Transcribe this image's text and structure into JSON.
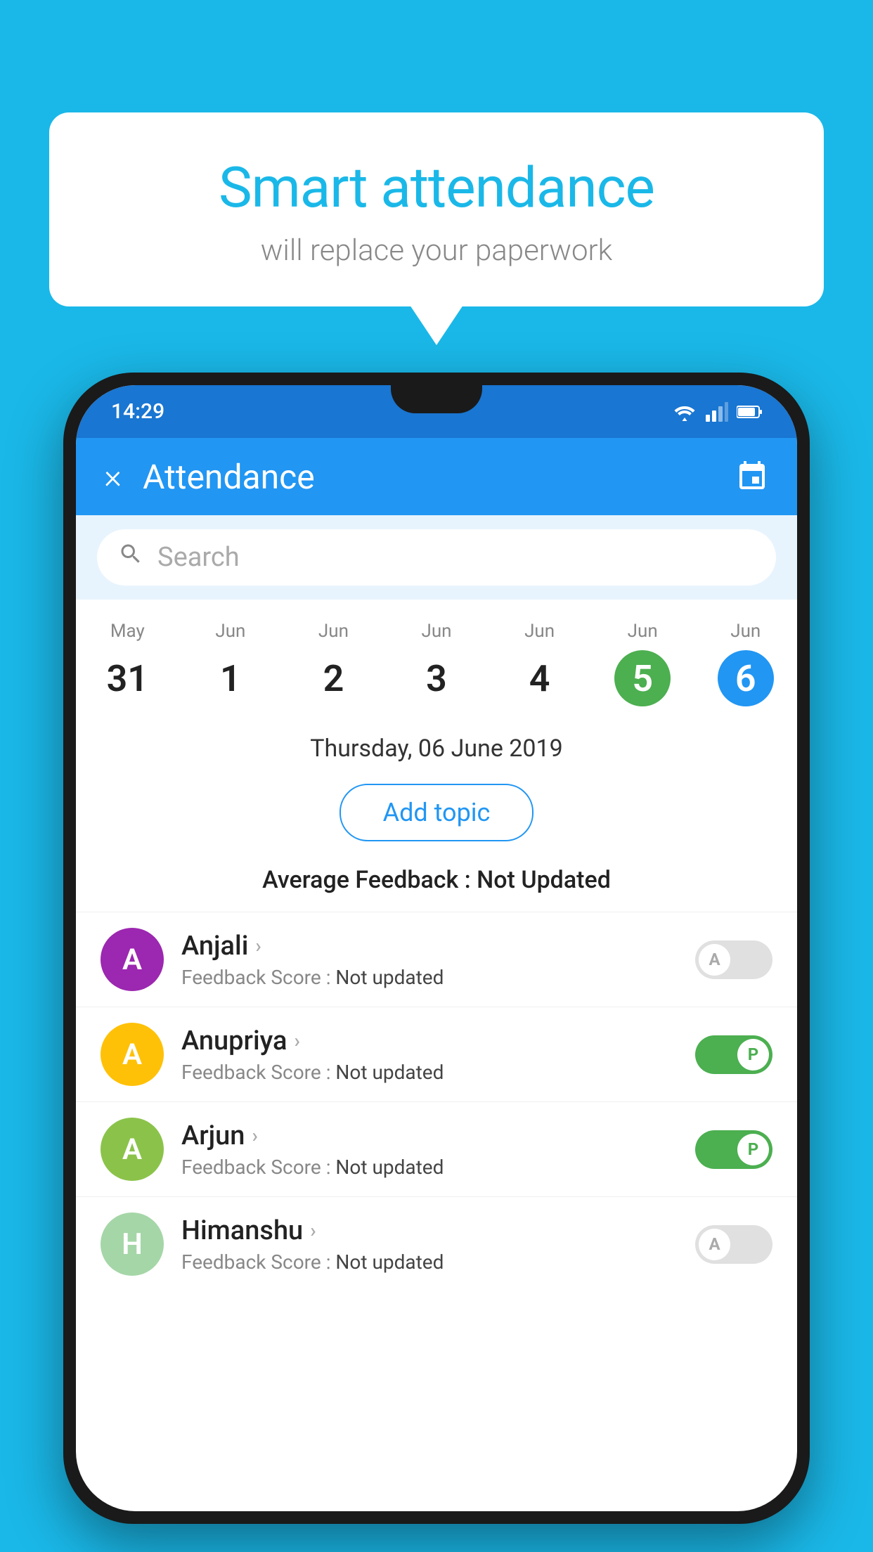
{
  "background_color": "#1ab8e8",
  "speech_bubble": {
    "title": "Smart attendance",
    "subtitle": "will replace your paperwork"
  },
  "status_bar": {
    "time": "14:29",
    "icons": [
      "wifi",
      "signal",
      "battery"
    ]
  },
  "app_bar": {
    "title": "Attendance",
    "close_label": "×",
    "calendar_icon": "📅"
  },
  "search": {
    "placeholder": "Search"
  },
  "calendar": {
    "days": [
      {
        "month": "May",
        "date": "31",
        "state": "normal"
      },
      {
        "month": "Jun",
        "date": "1",
        "state": "normal"
      },
      {
        "month": "Jun",
        "date": "2",
        "state": "normal"
      },
      {
        "month": "Jun",
        "date": "3",
        "state": "normal"
      },
      {
        "month": "Jun",
        "date": "4",
        "state": "normal"
      },
      {
        "month": "Jun",
        "date": "5",
        "state": "today"
      },
      {
        "month": "Jun",
        "date": "6",
        "state": "selected"
      }
    ]
  },
  "selected_date": "Thursday, 06 June 2019",
  "add_topic_label": "Add topic",
  "average_feedback": {
    "label": "Average Feedback : ",
    "value": "Not Updated"
  },
  "students": [
    {
      "name": "Anjali",
      "avatar_letter": "A",
      "avatar_color": "#9c27b0",
      "feedback_label": "Feedback Score : ",
      "feedback_value": "Not updated",
      "toggle": "off",
      "toggle_letter": "A"
    },
    {
      "name": "Anupriya",
      "avatar_letter": "A",
      "avatar_color": "#ffc107",
      "feedback_label": "Feedback Score : ",
      "feedback_value": "Not updated",
      "toggle": "on",
      "toggle_letter": "P"
    },
    {
      "name": "Arjun",
      "avatar_letter": "A",
      "avatar_color": "#8bc34a",
      "feedback_label": "Feedback Score : ",
      "feedback_value": "Not updated",
      "toggle": "on",
      "toggle_letter": "P"
    },
    {
      "name": "Himanshu",
      "avatar_letter": "H",
      "avatar_color": "#a5d6a7",
      "feedback_label": "Feedback Score : ",
      "feedback_value": "Not updated",
      "toggle": "off",
      "toggle_letter": "A"
    }
  ]
}
